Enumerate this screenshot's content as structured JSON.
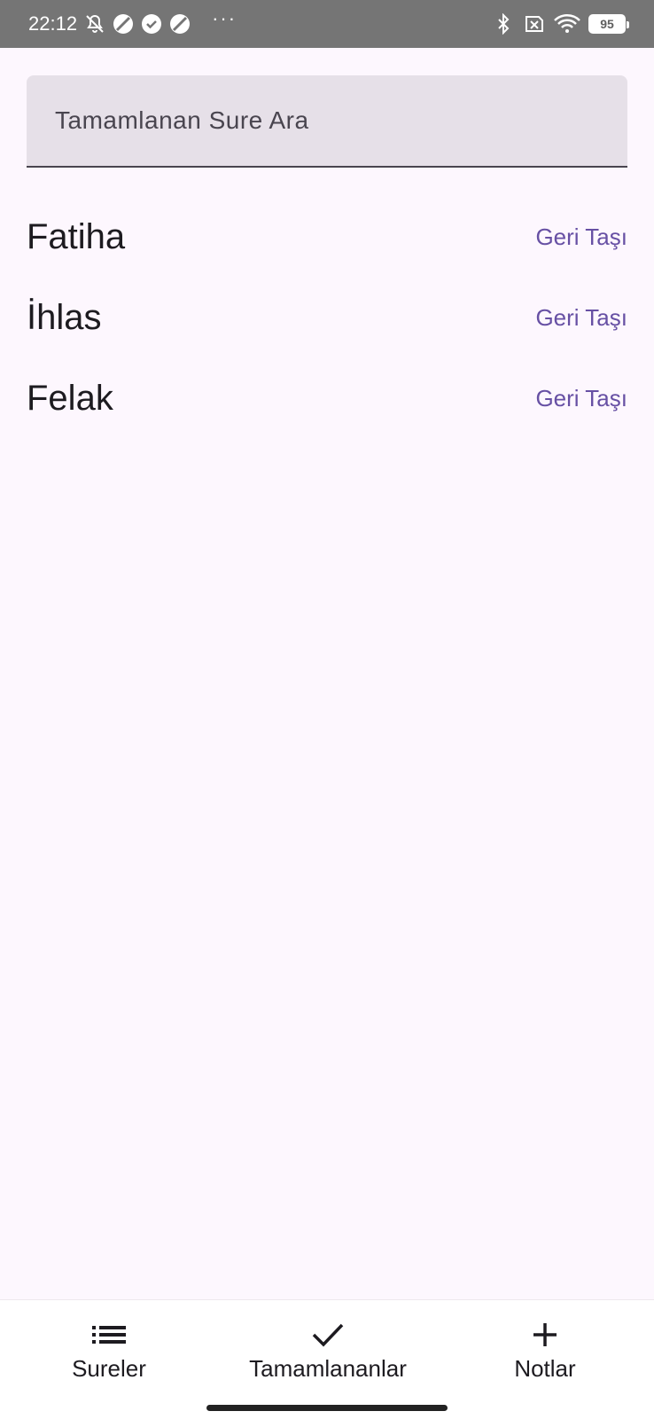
{
  "status_bar": {
    "time": "22:12",
    "battery_level": "95",
    "left_icons": [
      "muted-bell-icon",
      "app-icon",
      "check-circle-icon",
      "app-icon",
      "more-dots-icon"
    ],
    "right_icons": [
      "bluetooth-icon",
      "no-sim-icon",
      "wifi-icon",
      "battery-icon"
    ],
    "more": "···"
  },
  "search": {
    "placeholder": "Tamamlanan Sure Ara",
    "value": ""
  },
  "list": {
    "items": [
      {
        "title": "Fatiha",
        "action": "Geri Taşı"
      },
      {
        "title": "İhlas",
        "action": "Geri Taşı"
      },
      {
        "title": "Felak",
        "action": "Geri Taşı"
      }
    ]
  },
  "bottom_nav": {
    "items": [
      {
        "label": "Sureler",
        "icon": "list-icon"
      },
      {
        "label": "Tamamlananlar",
        "icon": "check-icon"
      },
      {
        "label": "Notlar",
        "icon": "plus-icon"
      }
    ]
  },
  "colors": {
    "background": "#fdf7fe",
    "search_fill": "#e6e0e8",
    "accent": "#6750a4",
    "status_bar": "#757575"
  }
}
